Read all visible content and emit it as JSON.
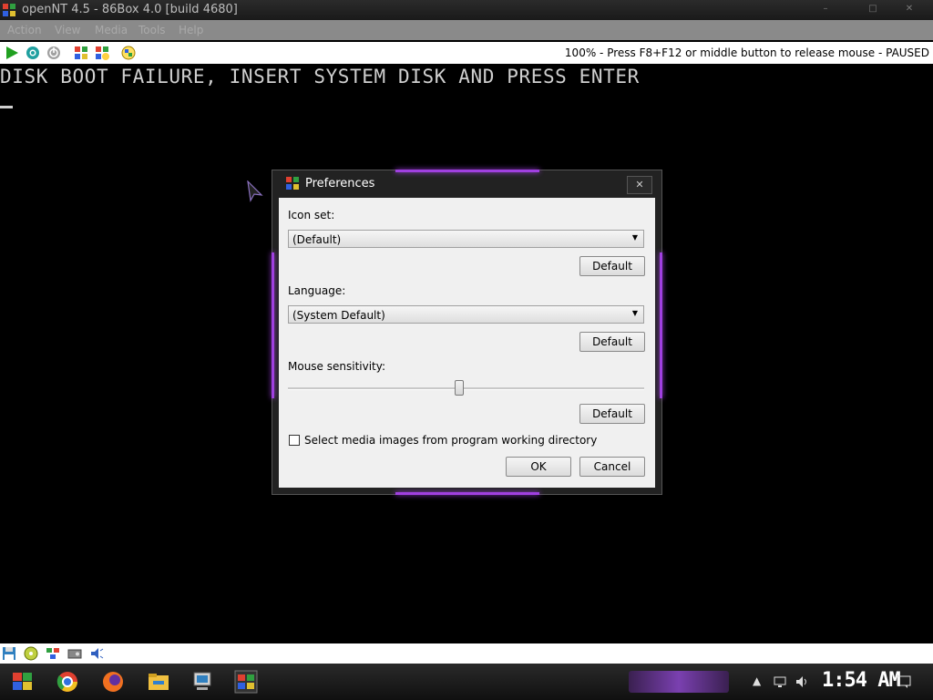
{
  "window": {
    "title": "openNT 4.5 - 86Box 4.0 [build 4680]",
    "controls": {
      "minimize": "–",
      "maximize": "□",
      "close": "✕"
    }
  },
  "menu": {
    "items": [
      "Action",
      "View",
      "Media",
      "Tools",
      "Help"
    ]
  },
  "toolbar": {
    "status": "100% - Press F8+F12 or middle button to release mouse - PAUSED"
  },
  "screen": {
    "boot_message": "DISK BOOT FAILURE, INSERT SYSTEM DISK AND PRESS ENTER"
  },
  "dialog": {
    "title": "Preferences",
    "close": "✕",
    "icon_set_label": "Icon set:",
    "icon_set_value": "(Default)",
    "language_label": "Language:",
    "language_value": "(System Default)",
    "mouse_label": "Mouse sensitivity:",
    "mouse_sensitivity_fraction": 0.48,
    "default_label": "Default",
    "checkbox_label": "Select media images from program working directory",
    "checkbox_checked": false,
    "ok_label": "OK",
    "cancel_label": "Cancel"
  },
  "taskbar": {
    "clock": "1:54 AM"
  },
  "colors": {
    "accent_purple": "#a040e0",
    "toolbar_bg": "#ffffff",
    "dialog_bg": "#f0f0f0"
  }
}
